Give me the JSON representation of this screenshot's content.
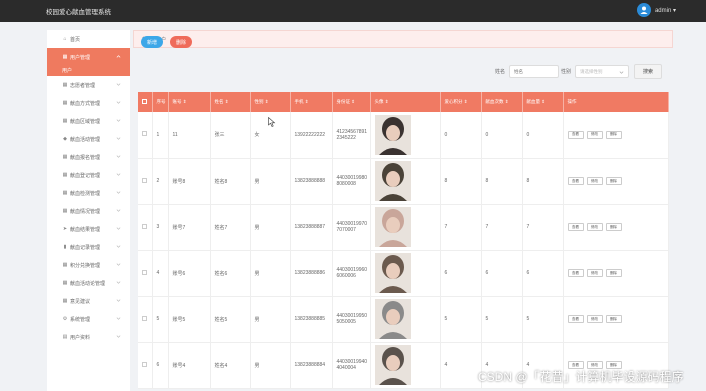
{
  "app": {
    "title": "校园爱心献血管理系统",
    "user": "admin ▾"
  },
  "sidebar": {
    "items": [
      {
        "label": "首页",
        "icon": "home-icon"
      },
      {
        "label": "用户管理",
        "icon": "grid-icon",
        "active": true
      },
      {
        "label": "志愿者管理",
        "icon": "grid-icon"
      },
      {
        "label": "献血方式管理",
        "icon": "grid-icon"
      },
      {
        "label": "献血区域管理",
        "icon": "grid-icon"
      },
      {
        "label": "献血活动管理",
        "icon": "tag-icon"
      },
      {
        "label": "献血报名管理",
        "icon": "grid-icon"
      },
      {
        "label": "献血登记管理",
        "icon": "grid-icon"
      },
      {
        "label": "献血检测管理",
        "icon": "grid-icon"
      },
      {
        "label": "献血情况管理",
        "icon": "grid-icon"
      },
      {
        "label": "献血结果管理",
        "icon": "send-icon"
      },
      {
        "label": "献血记录管理",
        "icon": "chart-icon"
      },
      {
        "label": "积分兑换管理",
        "icon": "grid-icon"
      },
      {
        "label": "献血活动论管理",
        "icon": "grid-icon"
      },
      {
        "label": "意见建议",
        "icon": "grid-icon"
      },
      {
        "label": "系统管理",
        "icon": "gear-icon"
      },
      {
        "label": "用户资料",
        "icon": "doc-icon"
      }
    ],
    "sub_label": "用户"
  },
  "breadcrumb": "首页 / 用户",
  "toolbar": {
    "add": "新增",
    "delete": "删除"
  },
  "search": {
    "name_label": "姓名",
    "name_placeholder": "姓名",
    "gender_label": "性别",
    "gender_placeholder": "请选择性别",
    "button": "搜索"
  },
  "table": {
    "headers": [
      "序号",
      "账号 ⇕",
      "姓名 ⇕",
      "性别 ⇕",
      "手机 ⇕",
      "身份证 ⇕",
      "头像 ⇕",
      "爱心积分 ⇕",
      "献血次数 ⇕",
      "献血量 ⇕",
      "操作"
    ],
    "rows": [
      {
        "no": "1",
        "account": "11",
        "name": "张三",
        "gender": "女",
        "phone": "13922222222",
        "idcard": "412345678912345222",
        "points": "0",
        "times": "0",
        "amount": "0",
        "photo": "#3a3230"
      },
      {
        "no": "2",
        "account": "账号8",
        "name": "姓名8",
        "gender": "男",
        "phone": "13823888888",
        "idcard": "440300199808080008",
        "points": "8",
        "times": "8",
        "amount": "8",
        "photo": "#4a4238"
      },
      {
        "no": "3",
        "account": "账号7",
        "name": "姓名7",
        "gender": "男",
        "phone": "13823888887",
        "idcard": "440300199707070007",
        "points": "7",
        "times": "7",
        "amount": "7",
        "photo": "#c9a69a"
      },
      {
        "no": "4",
        "account": "账号6",
        "name": "姓名6",
        "gender": "男",
        "phone": "13823888886",
        "idcard": "440300199606060006",
        "points": "6",
        "times": "6",
        "amount": "6",
        "photo": "#6b5a4e"
      },
      {
        "no": "5",
        "account": "账号5",
        "name": "姓名5",
        "gender": "男",
        "phone": "13823888885",
        "idcard": "440300199505050005",
        "points": "5",
        "times": "5",
        "amount": "5",
        "photo": "#8a8a8a"
      },
      {
        "no": "6",
        "account": "账号4",
        "name": "姓名4",
        "gender": "男",
        "phone": "13823888884",
        "idcard": "440300199404040004",
        "points": "4",
        "times": "4",
        "amount": "4",
        "photo": "#5a524c"
      }
    ],
    "ops": [
      "查看",
      "修改",
      "删除"
    ]
  },
  "watermark": "CSDN @「花昔」计算机毕设源码程序"
}
